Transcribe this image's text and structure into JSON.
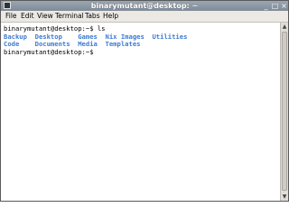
{
  "window": {
    "title": "binarymutant@desktop: ~",
    "minimize_glyph": "_",
    "maximize_glyph": "□",
    "close_glyph": "×"
  },
  "menubar": {
    "file": "File",
    "edit": "Edit",
    "view": "View",
    "terminal": "Terminal",
    "tabs": "Tabs",
    "help": "Help"
  },
  "terminal": {
    "prompt": "binarymutant@desktop:~$",
    "command": " ls",
    "listing_row1": [
      "Backup",
      "Desktop",
      "Games",
      "Nix Images",
      "Utilities"
    ],
    "listing_row2": [
      "Code",
      "Documents",
      "Media",
      "Templates"
    ],
    "directory_color": "#3e7bd1"
  },
  "scrollbar": {
    "up_arrow": "▲",
    "down_arrow": "▼"
  }
}
